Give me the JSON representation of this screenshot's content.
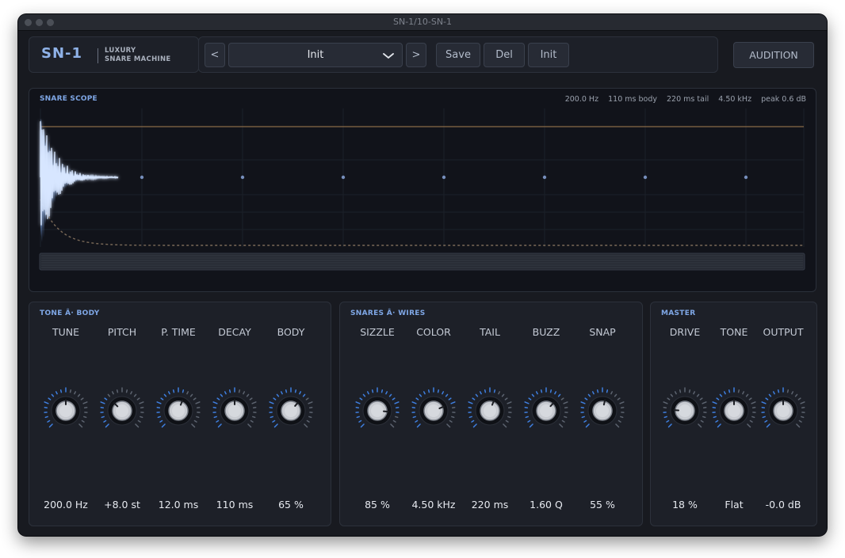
{
  "window": {
    "title": "SN-1/10-SN-1"
  },
  "brand": {
    "name": "SN-1",
    "line1": "LUXURY",
    "line2": "SNARE MACHINE"
  },
  "toolbar": {
    "prev_label": "<",
    "preset_name": "Init",
    "next_label": ">",
    "save_label": "Save",
    "del_label": "Del",
    "init_label": "Init",
    "audition_label": "AUDITION"
  },
  "scope": {
    "title": "SNARE SCOPE",
    "stats": {
      "freq": "200.0 Hz",
      "body": "110 ms body",
      "tail": "220 ms tail",
      "color": "4.50 kHz",
      "peak": "peak 0.6 dB"
    }
  },
  "sections": {
    "tone_body": {
      "title": "TONE Â· BODY",
      "knobs": [
        {
          "label": "TUNE",
          "value": "200.0 Hz",
          "level": 0.5
        },
        {
          "label": "PITCH",
          "value": "+8.0 st",
          "level": 0.33
        },
        {
          "label": "P. TIME",
          "value": "12.0 ms",
          "level": 0.58
        },
        {
          "label": "DECAY",
          "value": "110 ms",
          "level": 0.5
        },
        {
          "label": "BODY",
          "value": "65 %",
          "level": 0.65
        }
      ]
    },
    "snares_wires": {
      "title": "SNARES Â· WIRES",
      "knobs": [
        {
          "label": "SIZZLE",
          "value": "85 %",
          "level": 0.85
        },
        {
          "label": "COLOR",
          "value": "4.50 kHz",
          "level": 0.75
        },
        {
          "label": "TAIL",
          "value": "220 ms",
          "level": 0.58
        },
        {
          "label": "BUZZ",
          "value": "1.60 Q",
          "level": 0.66
        },
        {
          "label": "SNAP",
          "value": "55 %",
          "level": 0.55
        }
      ]
    },
    "master": {
      "title": "MASTER",
      "knobs": [
        {
          "label": "DRIVE",
          "value": "18 %",
          "level": 0.18
        },
        {
          "label": "TONE",
          "value": "Flat",
          "level": 0.5
        },
        {
          "label": "OUTPUT",
          "value": "-0.0 dB",
          "level": 0.5
        }
      ]
    }
  },
  "colors": {
    "accent": "#7fa7e6",
    "waveform": "#cfe0ff",
    "tick_active": "#3f7fe0",
    "tick_inactive": "#5d6470",
    "envelope_line": "#8a6a47"
  }
}
